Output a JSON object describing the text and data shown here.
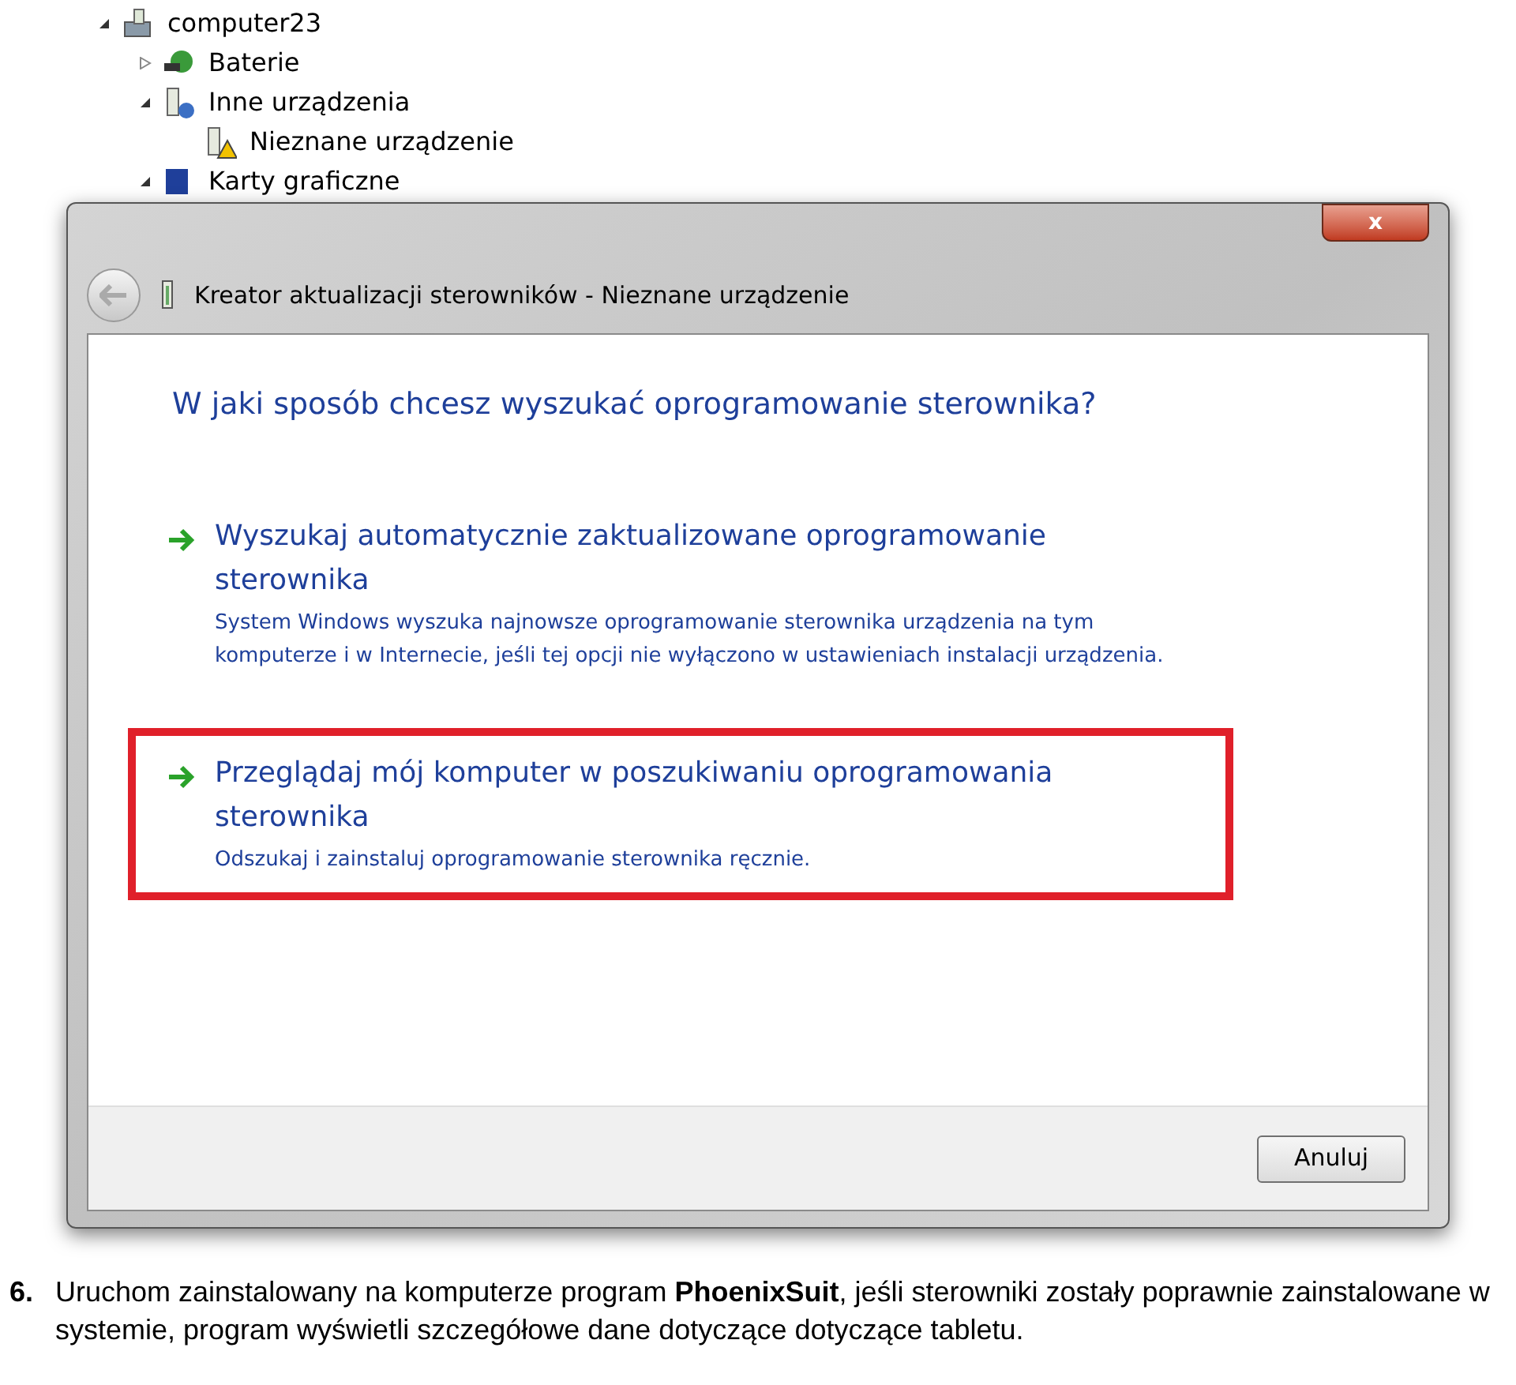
{
  "tree": [
    {
      "label": "computer23",
      "expanded": true,
      "kind": "computer",
      "children": [
        {
          "label": "Baterie",
          "expanded": false,
          "kind": "battery"
        },
        {
          "label": "Inne urządzenia",
          "expanded": true,
          "kind": "unknown",
          "children": [
            {
              "label": "Nieznane urządzenie",
              "kind": "warning"
            }
          ]
        },
        {
          "label": "Karty graficzne",
          "expanded": true,
          "kind": "display"
        }
      ]
    }
  ],
  "dialog": {
    "title": "Kreator aktualizacji sterowników - Nieznane urządzenie",
    "close": "x",
    "heading": "W jaki sposób chcesz wyszukać oprogramowanie sterownika?",
    "options": [
      {
        "title": "Wyszukaj automatycznie zaktualizowane oprogramowanie sterownika",
        "description": "System Windows wyszuka najnowsze oprogramowanie sterownika urządzenia na tym komputerze i w Internecie, jeśli tej opcji nie wyłączono w ustawieniach instalacji urządzenia.",
        "highlighted": false
      },
      {
        "title": "Przeglądaj mój komputer w poszukiwaniu oprogramowania sterownika",
        "description": "Odszukaj i zainstaluj oprogramowanie sterownika ręcznie.",
        "highlighted": true
      }
    ],
    "cancel_button": "Anuluj"
  },
  "caption": {
    "number": "6.",
    "text": "Uruchom zainstalowany na komputerze program **PhoenixSuit**, jeśli sterowniki zostały poprawnie zainstalowane w systemie, program wyświetli szczegółowe dane dotyczące dotyczące tabletu."
  }
}
